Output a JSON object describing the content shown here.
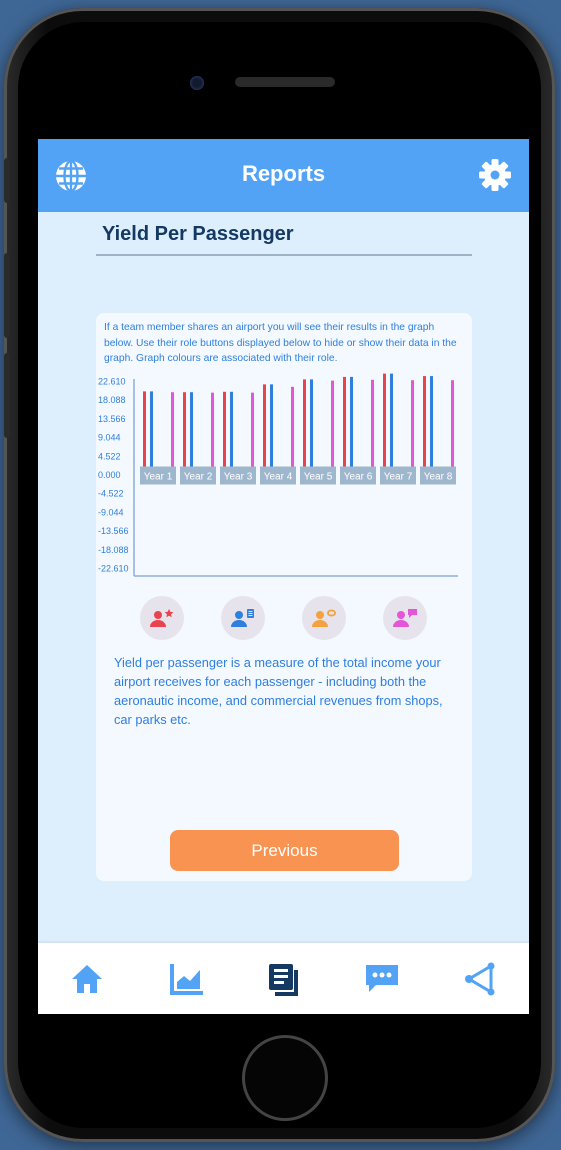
{
  "header": {
    "title": "Reports",
    "left_icon": "globe-icon",
    "right_icon": "gear-icon"
  },
  "page": {
    "title": "Yield Per Passenger"
  },
  "card": {
    "intro": "If a team member shares an airport you will see their results in the graph below. Use their role buttons displayed below to hide or show their data in the graph. Graph colours are associated with their role.",
    "description": "Yield per passenger is a measure of the total income your airport receives for each passenger - including both the aeronautic income, and commercial revenues from shops, car parks etc.",
    "previous_label": "Previous"
  },
  "roles": [
    {
      "icon": "user-star-icon",
      "color": "#e8434f"
    },
    {
      "icon": "user-list-icon",
      "color": "#2f7fde"
    },
    {
      "icon": "user-money-icon",
      "color": "#f4a23f"
    },
    {
      "icon": "user-chat-icon",
      "color": "#e357d6"
    }
  ],
  "chart_data": {
    "type": "bar",
    "categories": [
      "Year 1",
      "Year 2",
      "Year 3",
      "Year 4",
      "Year 5",
      "Year 6",
      "Year 7",
      "Year 8"
    ],
    "y_tick_labels": [
      "22.610",
      "18.088",
      "13.566",
      "9.044",
      "4.522",
      "0.000",
      "-4.522",
      "-9.044",
      "-13.566",
      "-18.088",
      "-22.610"
    ],
    "ylim": [
      -22.61,
      22.61
    ],
    "series": [
      {
        "color": "#e8434f",
        "values": [
          20.1,
          19.9,
          20.0,
          21.8,
          23.0,
          23.6,
          24.4,
          23.8
        ]
      },
      {
        "color": "#2f7fde",
        "values": [
          20.1,
          19.9,
          20.0,
          21.8,
          23.0,
          23.6,
          24.4,
          23.8
        ]
      },
      {
        "color": "#e357d6",
        "values": [
          19.9,
          19.8,
          19.8,
          21.2,
          22.7,
          22.9,
          22.8,
          22.8
        ]
      }
    ]
  },
  "nav": [
    {
      "icon": "home-icon",
      "color": "#52a3f5"
    },
    {
      "icon": "chart-icon",
      "color": "#52a3f5"
    },
    {
      "icon": "reports-icon",
      "color": "#143a63"
    },
    {
      "icon": "chat-icon",
      "color": "#52a3f5"
    },
    {
      "icon": "share-icon",
      "color": "#52a3f5"
    }
  ]
}
